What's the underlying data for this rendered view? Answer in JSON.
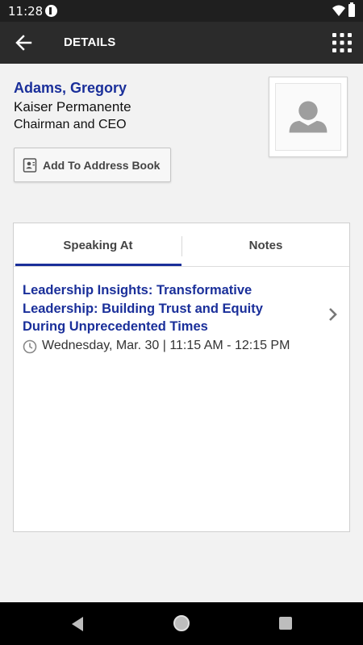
{
  "status_bar": {
    "time": "11:28",
    "icons": [
      "app-notification-icon",
      "wifi-icon",
      "battery-icon"
    ]
  },
  "app_bar": {
    "title": "DETAILS",
    "icons": [
      "back-arrow-icon",
      "grid-menu-icon"
    ]
  },
  "person": {
    "name": "Adams, Gregory",
    "organization": "Kaiser Permanente",
    "title": "Chairman and CEO",
    "avatar_icon": "person-placeholder-icon"
  },
  "address_book_button": {
    "label": "Add To Address Book",
    "icon": "contact-card-icon"
  },
  "tabs": [
    {
      "label": "Speaking At",
      "active": true
    },
    {
      "label": "Notes",
      "active": false
    }
  ],
  "sessions": [
    {
      "title": "Leadership Insights: Transformative Leadership: Building Trust and Equity During Unprecedented Times",
      "time": "Wednesday, Mar. 30 | 11:15 AM - 12:15 PM",
      "icon": "clock-icon"
    }
  ],
  "nav_bar": {
    "icons": [
      "nav-back-icon",
      "nav-home-icon",
      "nav-recents-icon"
    ]
  },
  "colors": {
    "accent": "#1a2f9a",
    "app_bar": "#2b2b2b",
    "background": "#f2f2f2"
  }
}
